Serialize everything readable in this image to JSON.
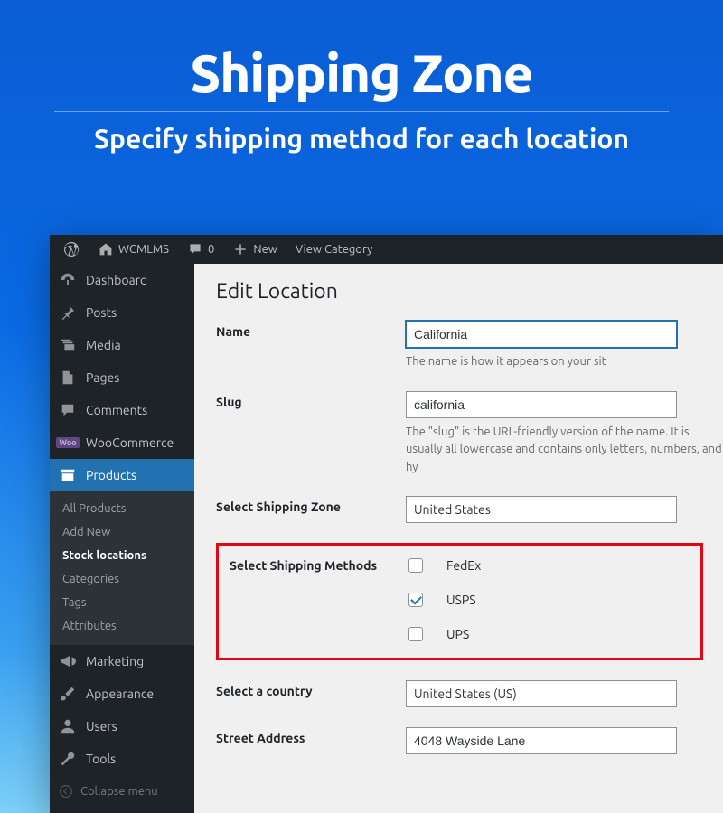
{
  "hero": {
    "title": "Shipping Zone",
    "subtitle": "Specify shipping method for each location"
  },
  "adminbar": {
    "site_name": "WCMLMS",
    "comments_count": "0",
    "new_label": "New",
    "view_label": "View Category"
  },
  "sidebar": {
    "dashboard": "Dashboard",
    "posts": "Posts",
    "media": "Media",
    "pages": "Pages",
    "comments": "Comments",
    "woocommerce_label": "WooCommerce",
    "products": "Products",
    "submenu": {
      "all": "All Products",
      "add": "Add New",
      "stock": "Stock locations",
      "categories": "Categories",
      "tags": "Tags",
      "attributes": "Attributes"
    },
    "marketing": "Marketing",
    "appearance": "Appearance",
    "users": "Users",
    "tools": "Tools",
    "collapse": "Collapse menu"
  },
  "content": {
    "heading": "Edit Location",
    "name_label": "Name",
    "name_value": "California",
    "name_desc": "The name is how it appears on your sit",
    "slug_label": "Slug",
    "slug_value": "california",
    "slug_desc": "The \"slug\" is the URL-friendly version of the name. It is usually all lowercase and contains only letters, numbers, and hy",
    "zone_label": "Select Shipping Zone",
    "zone_value": "United States",
    "methods_label": "Select Shipping Methods",
    "methods": [
      {
        "name": "FedEx",
        "checked": false
      },
      {
        "name": "USPS",
        "checked": true
      },
      {
        "name": "UPS",
        "checked": false
      }
    ],
    "country_label": "Select a country",
    "country_value": "United States (US)",
    "street_label": "Street Address",
    "street_value": "4048 Wayside Lane"
  }
}
